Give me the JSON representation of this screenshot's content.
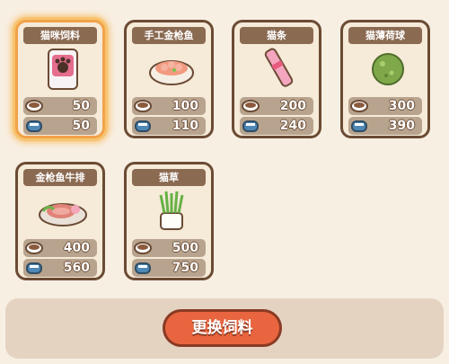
{
  "items": [
    {
      "name": "猫咪饲料",
      "food_cost": "50",
      "can_cost": "50"
    },
    {
      "name": "手工金枪鱼",
      "food_cost": "100",
      "can_cost": "110"
    },
    {
      "name": "猫条",
      "food_cost": "200",
      "can_cost": "240"
    },
    {
      "name": "猫薄荷球",
      "food_cost": "300",
      "can_cost": "390"
    },
    {
      "name": "金枪鱼牛排",
      "food_cost": "400",
      "can_cost": "560"
    },
    {
      "name": "猫草",
      "food_cost": "500",
      "can_cost": "750"
    }
  ],
  "footer": {
    "change_food_label": "更换饲料"
  },
  "icons": {
    "food": "cat-food-bowl-icon",
    "can": "tuna-can-icon"
  },
  "colors": {
    "accent": "#e8653f",
    "selected_glow": "#f7c46e"
  }
}
